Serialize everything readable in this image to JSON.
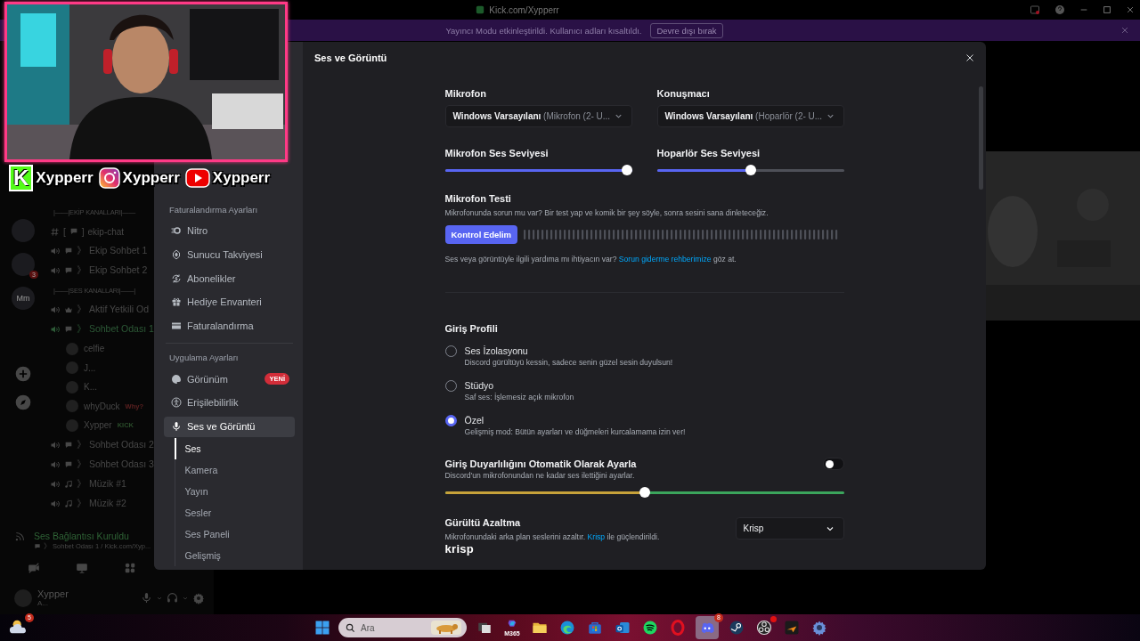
{
  "titlebar": {
    "title": "Kick.com/Xypperr"
  },
  "banner": {
    "message": "Yayıncı Modu etkinleştirildi. Kullanıcı adları kısaltıldı.",
    "action": "Devre dışı bırak"
  },
  "stream_overlay": {
    "handles": [
      {
        "kind": "kick",
        "logo": "K",
        "name": "Xypperr"
      },
      {
        "kind": "instagram",
        "name": "Xypperr"
      },
      {
        "kind": "youtube",
        "name": "Xypperr"
      }
    ]
  },
  "servers": [
    {
      "kind": "avatar"
    },
    {
      "kind": "avatar",
      "badge": "3"
    },
    {
      "kind": "label",
      "label": "Mm"
    },
    {
      "kind": "add"
    },
    {
      "kind": "explore"
    }
  ],
  "channels": [
    {
      "kind": "category",
      "name": "|——|EKİP KANALLARI|——"
    },
    {
      "kind": "text",
      "open": "[",
      "close": "]",
      "name": "ekip-chat"
    },
    {
      "kind": "voice",
      "close": "》",
      "name": "Ekip Sohbet 1",
      "connected": false
    },
    {
      "kind": "voice",
      "close": "》",
      "name": "Ekip Sohbet 2",
      "connected": false
    },
    {
      "kind": "category",
      "name": "|——|SES KANALLARI|——|"
    },
    {
      "kind": "staff",
      "close": "》",
      "name": "Aktif Yetkili Od",
      "connected": false
    },
    {
      "kind": "voice",
      "close": "》",
      "name": "Sohbet Odası 1",
      "connected": true
    },
    {
      "kind": "user",
      "name": "celfie"
    },
    {
      "kind": "user",
      "name": "J..."
    },
    {
      "kind": "user",
      "name": "K..."
    },
    {
      "kind": "user",
      "name": "whyDuck",
      "tag": "Why?"
    },
    {
      "kind": "user",
      "name": "Xypper",
      "tag": "KICK"
    },
    {
      "kind": "voice",
      "close": "》",
      "name": "Sohbet Odası 2",
      "connected": false
    },
    {
      "kind": "voice",
      "close": "》",
      "name": "Sohbet Odası 3",
      "connected": false
    },
    {
      "kind": "music",
      "close": "》",
      "name": "Müzik #1",
      "connected": false
    },
    {
      "kind": "music",
      "close": "》",
      "name": "Müzik #2",
      "connected": false
    }
  ],
  "voice_status": {
    "title": "Ses Bağlantısı Kuruldu",
    "close": "》",
    "channel": "Sohbet Odası 1 / Kick.com/Xyp..."
  },
  "user_panel": {
    "name": "Xypper",
    "status": "A..."
  },
  "settings": {
    "title": "Ses ve Görüntü",
    "sidebar": [
      {
        "kind": "header",
        "label": "Faturalandırma Ayarları"
      },
      {
        "kind": "item",
        "label": "Nitro",
        "selected": false
      },
      {
        "kind": "item",
        "label": "Sunucu Takviyesi",
        "selected": false
      },
      {
        "kind": "item",
        "label": "Abonelikler",
        "selected": false
      },
      {
        "kind": "item",
        "label": "Hediye Envanteri",
        "selected": false
      },
      {
        "kind": "item",
        "label": "Faturalandırma",
        "selected": false
      },
      {
        "kind": "header",
        "label": "Uygulama Ayarları"
      },
      {
        "kind": "item",
        "label": "Görünüm",
        "badge": "YENİ",
        "selected": false
      },
      {
        "kind": "item",
        "label": "Erişilebilirlik",
        "selected": false
      },
      {
        "kind": "item",
        "label": "Ses ve Görüntü",
        "selected": true,
        "children": [
          {
            "label": "Ses",
            "selected": true
          },
          {
            "label": "Kamera",
            "selected": false
          },
          {
            "label": "Yayın",
            "selected": false
          },
          {
            "label": "Sesler",
            "selected": false
          },
          {
            "label": "Ses Paneli",
            "selected": false
          },
          {
            "label": "Gelişmiş",
            "selected": false
          }
        ]
      }
    ],
    "devices": [
      {
        "label": "Mikrofon",
        "value": "**Windows Varsayılanı** (Mikrofon (2- U..."
      },
      {
        "label": "Konuşmacı",
        "value": "**Windows Varsayılanı** (Hoparlör (2- U..."
      }
    ],
    "volumes": [
      {
        "label": "Mikrofon Ses Seviyesi",
        "level": 1
      },
      {
        "label": "Hoparlör Ses Seviyesi",
        "level": 0.5
      }
    ],
    "mic_test": {
      "title": "Mikrofon Testi",
      "description": "Mikrofonunda sorun mu var? Bir test yap ve komik bir şey söyle, sonra sesini sana dinleteceğiz.",
      "button": "Kontrol Edelim"
    },
    "help": {
      "before": "Ses veya görüntüyle ilgili yardıma mı ihtiyacın var?",
      "link": "Sorun giderme rehberimize",
      "after": "göz at."
    },
    "input_profile": {
      "title": "Giriş Profili",
      "options": [
        {
          "label": "Ses İzolasyonu",
          "description": "Discord gürültüyü kessin, sadece senin güzel sesin duyulsun!",
          "selected": false
        },
        {
          "label": "Stüdyo",
          "description": "Saf ses: İşlemesiz açık mikrofon",
          "selected": false
        },
        {
          "label": "Özel",
          "description": "Gelişmiş mod: Bütün ayarları ve düğmeleri kurcalamama izin ver!",
          "selected": true
        }
      ]
    },
    "auto_sensitivity": {
      "title": "Giriş Duyarlılığını Otomatik Olarak Ayarla",
      "description": "Discord'un mikrofonundan ne kadar ses ilettiğini ayarlar.",
      "on": false,
      "level": 0.5
    },
    "noise": {
      "title": "Gürültü Azaltma",
      "before": "Mikrofonundaki arka plan seslerini azaltır.",
      "link": "Krisp",
      "after": "ile güçlendirildi.",
      "value": "Krisp",
      "brand": "krisp"
    }
  },
  "taskbar": {
    "weather_badge": "5",
    "search": {
      "placeholder": "Ara"
    },
    "apps": [
      {
        "kind": "taskview",
        "selected": false,
        "alert": false
      },
      {
        "kind": "m365",
        "label": "M365",
        "selected": false,
        "alert": false
      },
      {
        "kind": "folder",
        "selected": false,
        "alert": false
      },
      {
        "kind": "edge",
        "selected": false,
        "alert": false
      },
      {
        "kind": "store",
        "selected": false,
        "alert": false
      },
      {
        "kind": "outlook",
        "selected": false,
        "alert": false
      },
      {
        "kind": "spotify",
        "selected": false,
        "alert": false
      },
      {
        "kind": "opera",
        "selected": false,
        "alert": false
      },
      {
        "kind": "discord",
        "badge": "8",
        "selected": true,
        "alert": false
      },
      {
        "kind": "steam",
        "selected": false,
        "alert": false
      },
      {
        "kind": "obs",
        "selected": false,
        "alert": true
      },
      {
        "kind": "arrow",
        "selected": false,
        "alert": false
      },
      {
        "kind": "settings",
        "selected": false,
        "alert": false
      }
    ]
  }
}
